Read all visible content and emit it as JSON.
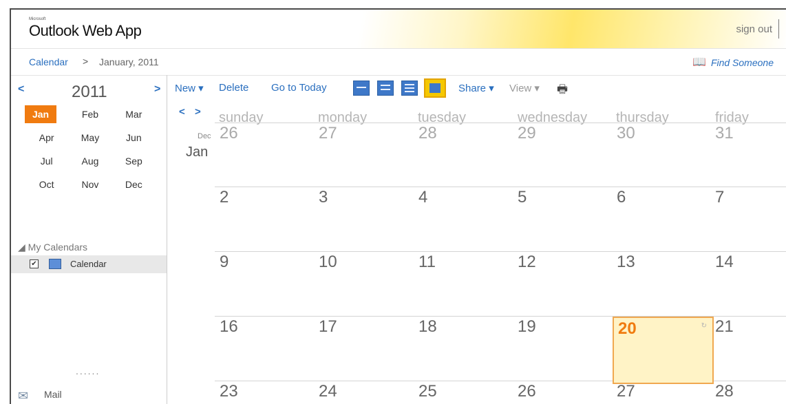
{
  "header": {
    "brand_small": "Microsoft",
    "logo": "Outlook Web App",
    "sign_out": "sign out"
  },
  "breadcrumb": {
    "calendar": "Calendar",
    "arrow": ">",
    "date": "January, 2011",
    "find_icon": "book-icon",
    "find_someone": "Find Someone"
  },
  "mini_calendar": {
    "prev": "<",
    "next": ">",
    "year": "2011",
    "months": [
      "Jan",
      "Feb",
      "Mar",
      "Apr",
      "May",
      "Jun",
      "Jul",
      "Aug",
      "Sep",
      "Oct",
      "Nov",
      "Dec"
    ],
    "selected_month": "Jan"
  },
  "my_calendars": {
    "heading": "My Calendars",
    "items": [
      {
        "label": "Calendar",
        "checked": true
      }
    ]
  },
  "mail": {
    "dots": "......",
    "label": "Mail",
    "icon": "mail-icon"
  },
  "toolbar": {
    "new": "New ▾",
    "delete": "Delete",
    "go_to_today": "Go to Today",
    "share": "Share ▾",
    "view": "View ▾",
    "view_buttons": [
      "day-view-icon",
      "work-week-view-icon",
      "week-view-icon",
      "month-view-icon"
    ],
    "selected_view": "month-view-icon",
    "print_icon": "printer-icon"
  },
  "calendar_grid": {
    "nav_prev": "<",
    "nav_next": ">",
    "first_row_month_small": "Dec",
    "first_row_month": "Jan",
    "day_names": [
      "sunday",
      "monday",
      "tuesday",
      "wednesday",
      "thursday",
      "friday"
    ],
    "weeks": [
      [
        "26",
        "27",
        "28",
        "29",
        "30",
        "31"
      ],
      [
        "2",
        "3",
        "4",
        "5",
        "6",
        "7"
      ],
      [
        "9",
        "10",
        "11",
        "12",
        "13",
        "14"
      ],
      [
        "16",
        "17",
        "18",
        "19",
        "20",
        "21"
      ],
      [
        "23",
        "24",
        "25",
        "26",
        "27",
        "28"
      ]
    ],
    "muted_week": 0,
    "today": "20",
    "today_marker": "↻",
    "today_color": "#f07b10"
  },
  "colors": {
    "link": "#2a6fbf",
    "accent": "#f07b10",
    "today_fill": "#fff3c6",
    "header_gold": "#ffe66a"
  }
}
